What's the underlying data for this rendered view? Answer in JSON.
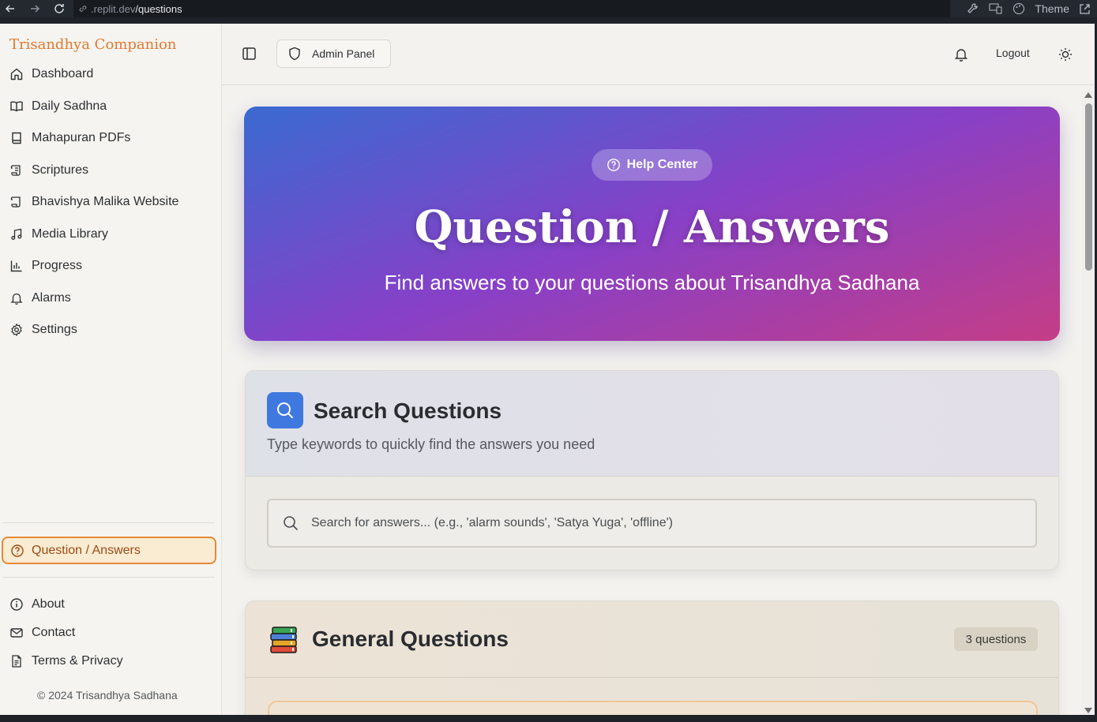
{
  "browser": {
    "url_host": ".replit.dev",
    "url_path": "/questions",
    "theme_label": "Theme"
  },
  "sidebar": {
    "brand": "Trisandhya Companion",
    "items": [
      {
        "label": "Dashboard",
        "icon": "home-icon"
      },
      {
        "label": "Daily Sadhna",
        "icon": "book-open-icon"
      },
      {
        "label": "Mahapuran PDFs",
        "icon": "book-icon"
      },
      {
        "label": "Scriptures",
        "icon": "scroll-icon"
      },
      {
        "label": "Bhavishya Malika Website",
        "icon": "scroll-icon"
      },
      {
        "label": "Media Library",
        "icon": "music-icon"
      },
      {
        "label": "Progress",
        "icon": "bar-chart-icon"
      },
      {
        "label": "Alarms",
        "icon": "bell-icon"
      },
      {
        "label": "Settings",
        "icon": "gear-icon"
      }
    ],
    "active_item": {
      "label": "Question / Answers",
      "icon": "help-circle-icon"
    },
    "footer_items": [
      {
        "label": "About",
        "icon": "info-icon"
      },
      {
        "label": "Contact",
        "icon": "mail-icon"
      },
      {
        "label": "Terms & Privacy",
        "icon": "file-text-icon"
      }
    ],
    "copyright": "© 2024 Trisandhya Sadhana"
  },
  "header": {
    "admin_label": "Admin Panel",
    "logout_label": "Logout"
  },
  "hero": {
    "pill_label": "Help Center",
    "title": "Question / Answers",
    "subtitle": "Find answers to your questions about Trisandhya Sadhana"
  },
  "search": {
    "title": "Search Questions",
    "description": "Type keywords to quickly find the answers you need",
    "placeholder": "Search for answers... (e.g., 'alarm sounds', 'Satya Yuga', 'offline')"
  },
  "general": {
    "title": "General Questions",
    "badge": "3 questions"
  },
  "colors": {
    "brand": "#e3782f",
    "accent_blue": "#3f79e0",
    "hero_start": "#3a6ad0",
    "hero_mid": "#8740c8",
    "hero_end": "#c53d86",
    "active_border": "#e58a3a"
  }
}
